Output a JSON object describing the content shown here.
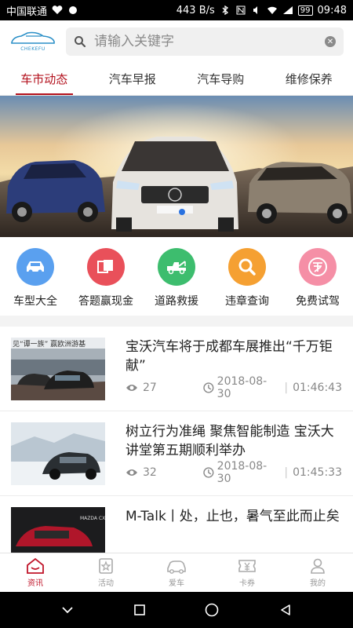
{
  "status_bar": {
    "carrier": "中国联通",
    "net_speed": "443 B/s",
    "battery": "99",
    "time": "09:48"
  },
  "header": {
    "logo_text": "CHEKEFU",
    "search_placeholder": "请输入关键字"
  },
  "tabs": [
    {
      "label": "车市动态",
      "active": true
    },
    {
      "label": "汽车早报",
      "active": false
    },
    {
      "label": "汽车导购",
      "active": false
    },
    {
      "label": "维修保养",
      "active": false
    }
  ],
  "quick_actions": [
    {
      "label": "车型大全",
      "icon": "car-icon",
      "color": "#5aa0ef"
    },
    {
      "label": "答题赢现金",
      "icon": "cards-icon",
      "color": "#e9505a"
    },
    {
      "label": "道路救援",
      "icon": "tow-truck-icon",
      "color": "#3dbd6e"
    },
    {
      "label": "违章查询",
      "icon": "search-icon",
      "color": "#f5a032"
    },
    {
      "label": "免费试驾",
      "icon": "free-icon",
      "color": "#f58fa6"
    }
  ],
  "news": [
    {
      "title": "宝沃汽车将于成都车展推出“千万钜献”",
      "views": "27",
      "date": "2018-08-30",
      "time": "01:46:43",
      "thumb_caption": "见“谭一族” 赢欧洲游基"
    },
    {
      "title": "树立行为准绳 聚焦智能制造 宝沃大讲堂第五期顺利举办",
      "views": "32",
      "date": "2018-08-30",
      "time": "01:45:33"
    },
    {
      "title": "M-Talk丨处，止也，暑气至此而止矣",
      "views": "",
      "date": "",
      "time": ""
    }
  ],
  "tabbar": [
    {
      "label": "资讯",
      "icon": "home-icon",
      "active": true
    },
    {
      "label": "活动",
      "icon": "star-badge-icon",
      "active": false
    },
    {
      "label": "爱车",
      "icon": "car-outline-icon",
      "active": false
    },
    {
      "label": "卡券",
      "icon": "coupon-icon",
      "active": false
    },
    {
      "label": "我的",
      "icon": "user-icon",
      "active": false
    }
  ],
  "colors": {
    "accent": "#b3111d",
    "tab_active": "#c0152a"
  }
}
